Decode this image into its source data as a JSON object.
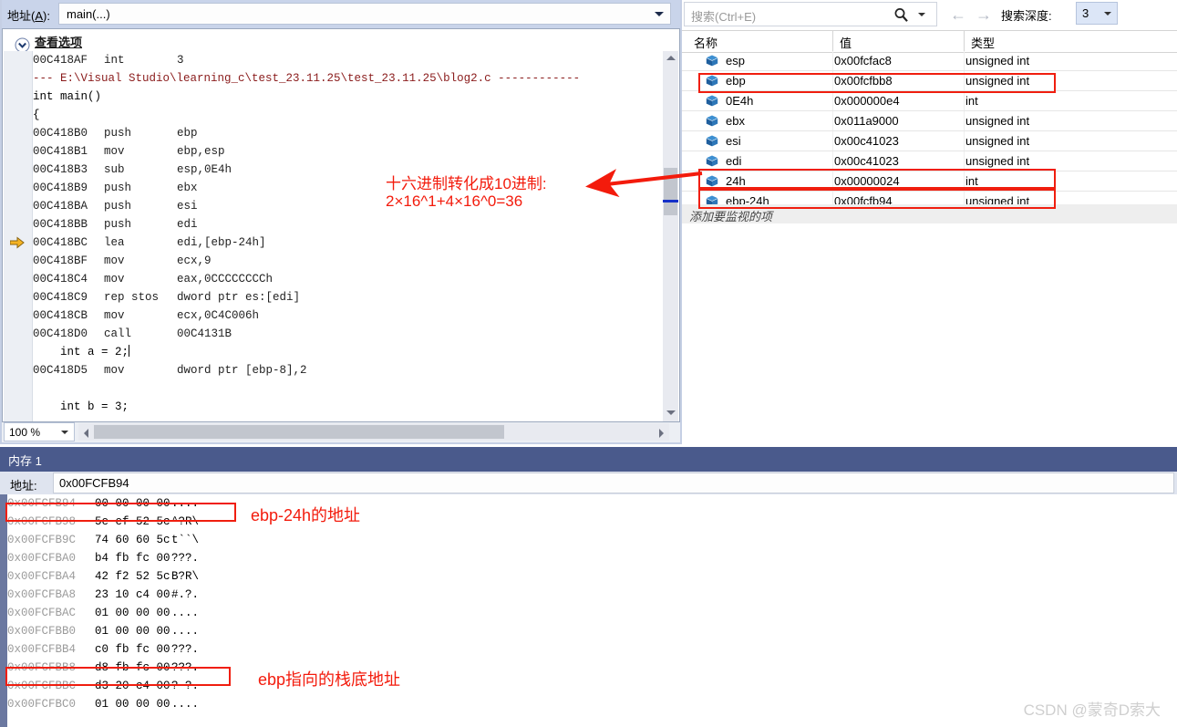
{
  "disassembly": {
    "address_bar": {
      "label_prefix": "地址(",
      "label_key": "A",
      "label_suffix": "):",
      "value": "main(...)",
      "dropdown_icon": "chevron-down-icon"
    },
    "view_options_label": "查看选项",
    "zoom_level": "100 %",
    "lines": [
      {
        "kind": "code",
        "addr": "00C418AF",
        "mnem": "int",
        "ops": "3",
        "current": false
      },
      {
        "kind": "path",
        "text": "--- E:\\Visual Studio\\learning_c\\test_23.11.25\\test_23.11.25\\blog2.c ------------"
      },
      {
        "kind": "src",
        "text": "int main()"
      },
      {
        "kind": "src",
        "text": "{"
      },
      {
        "kind": "code",
        "addr": "00C418B0",
        "mnem": "push",
        "ops": "ebp",
        "current": false
      },
      {
        "kind": "code",
        "addr": "00C418B1",
        "mnem": "mov",
        "ops": "ebp,esp",
        "current": false
      },
      {
        "kind": "code",
        "addr": "00C418B3",
        "mnem": "sub",
        "ops": "esp,0E4h",
        "current": false
      },
      {
        "kind": "code",
        "addr": "00C418B9",
        "mnem": "push",
        "ops": "ebx",
        "current": false
      },
      {
        "kind": "code",
        "addr": "00C418BA",
        "mnem": "push",
        "ops": "esi",
        "current": false
      },
      {
        "kind": "code",
        "addr": "00C418BB",
        "mnem": "push",
        "ops": "edi",
        "current": false
      },
      {
        "kind": "code",
        "addr": "00C418BC",
        "mnem": "lea",
        "ops": "edi,[ebp-24h]",
        "current": true
      },
      {
        "kind": "code",
        "addr": "00C418BF",
        "mnem": "mov",
        "ops": "ecx,9",
        "current": false
      },
      {
        "kind": "code",
        "addr": "00C418C4",
        "mnem": "mov",
        "ops": "eax,0CCCCCCCCh",
        "current": false
      },
      {
        "kind": "code",
        "addr": "00C418C9",
        "mnem": "rep stos",
        "ops": "dword ptr es:[edi]",
        "current": false
      },
      {
        "kind": "code",
        "addr": "00C418CB",
        "mnem": "mov",
        "ops": "ecx,0C4C006h",
        "current": false
      },
      {
        "kind": "code",
        "addr": "00C418D0",
        "mnem": "call",
        "ops": "00C4131B",
        "current": false
      },
      {
        "kind": "src",
        "text": "    int a = 2;",
        "caret": true
      },
      {
        "kind": "code",
        "addr": "00C418D5",
        "mnem": "mov",
        "ops": "dword ptr [ebp-8],2",
        "current": false
      },
      {
        "kind": "src",
        "text": ""
      },
      {
        "kind": "src",
        "text": "    int b = 3;"
      }
    ]
  },
  "watch": {
    "search_placeholder": "搜索(Ctrl+E)",
    "search_icon": "search-icon",
    "nav_back_icon": "arrow-left-icon",
    "nav_forward_icon": "arrow-right-icon",
    "depth_label": "搜索深度:",
    "depth_value": "3",
    "columns": [
      "名称",
      "值",
      "类型"
    ],
    "rows": [
      {
        "name": "esp",
        "value": "0x00fcfac8",
        "type": "unsigned int",
        "highlight": false
      },
      {
        "name": "ebp",
        "value": "0x00fcfbb8",
        "type": "unsigned int",
        "highlight": true
      },
      {
        "name": "0E4h",
        "value": "0x000000e4",
        "type": "int",
        "highlight": false
      },
      {
        "name": "ebx",
        "value": "0x011a9000",
        "type": "unsigned int",
        "highlight": false
      },
      {
        "name": "esi",
        "value": "0x00c41023",
        "type": "unsigned int",
        "highlight": false
      },
      {
        "name": "edi",
        "value": "0x00c41023",
        "type": "unsigned int",
        "highlight": false
      },
      {
        "name": "24h",
        "value": "0x00000024",
        "type": "int",
        "highlight": true
      },
      {
        "name": "ebp-24h",
        "value": "0x00fcfb94",
        "type": "unsigned int",
        "highlight": true
      }
    ],
    "add_item_hint": "添加要监视的项"
  },
  "memory": {
    "title": "内存 1",
    "address_label": "地址:",
    "address_value": "0x00FCFB94",
    "rows": [
      {
        "addr": "0x00FCFB94",
        "hex": "00 00 00 00",
        "ascii": "....",
        "highlight": true
      },
      {
        "addr": "0x00FCFB98",
        "hex": "5e ef 52 5c",
        "ascii": "^?R\\",
        "highlight": false
      },
      {
        "addr": "0x00FCFB9C",
        "hex": "74 60 60 5c",
        "ascii": "t``\\",
        "highlight": false
      },
      {
        "addr": "0x00FCFBA0",
        "hex": "b4 fb fc 00",
        "ascii": "???.",
        "highlight": false
      },
      {
        "addr": "0x00FCFBA4",
        "hex": "42 f2 52 5c",
        "ascii": "B?R\\",
        "highlight": false
      },
      {
        "addr": "0x00FCFBA8",
        "hex": "23 10 c4 00",
        "ascii": "#.?.",
        "highlight": false
      },
      {
        "addr": "0x00FCFBAC",
        "hex": "01 00 00 00",
        "ascii": "....",
        "highlight": false
      },
      {
        "addr": "0x00FCFBB0",
        "hex": "01 00 00 00",
        "ascii": "....",
        "highlight": false
      },
      {
        "addr": "0x00FCFBB4",
        "hex": "c0 fb fc 00",
        "ascii": "???.",
        "highlight": false
      },
      {
        "addr": "0x00FCFBB8",
        "hex": "d8 fb fc 00",
        "ascii": "???.",
        "highlight": true
      },
      {
        "addr": "0x00FCFBBC",
        "hex": "d3 20 c4 00",
        "ascii": "? ?.",
        "highlight": false
      },
      {
        "addr": "0x00FCFBC0",
        "hex": "01 00 00 00",
        "ascii": "....",
        "highlight": false
      }
    ]
  },
  "annotations": {
    "hex_conversion_line1": "十六进制转化成10进制:",
    "hex_conversion_line2": "2×16^1+4×16^0=36",
    "mem_note_1": "ebp-24h的地址",
    "mem_note_2": "ebp指向的栈底地址"
  },
  "watermark": "CSDN @蒙奇D索大",
  "colors": {
    "annotation_red": "#f31b0c",
    "highlight_box": "#f01e0f",
    "title_bar": "#4a5a8c",
    "path_text": "#8a1b1b",
    "scroll_marker_blue": "#1430c8"
  }
}
